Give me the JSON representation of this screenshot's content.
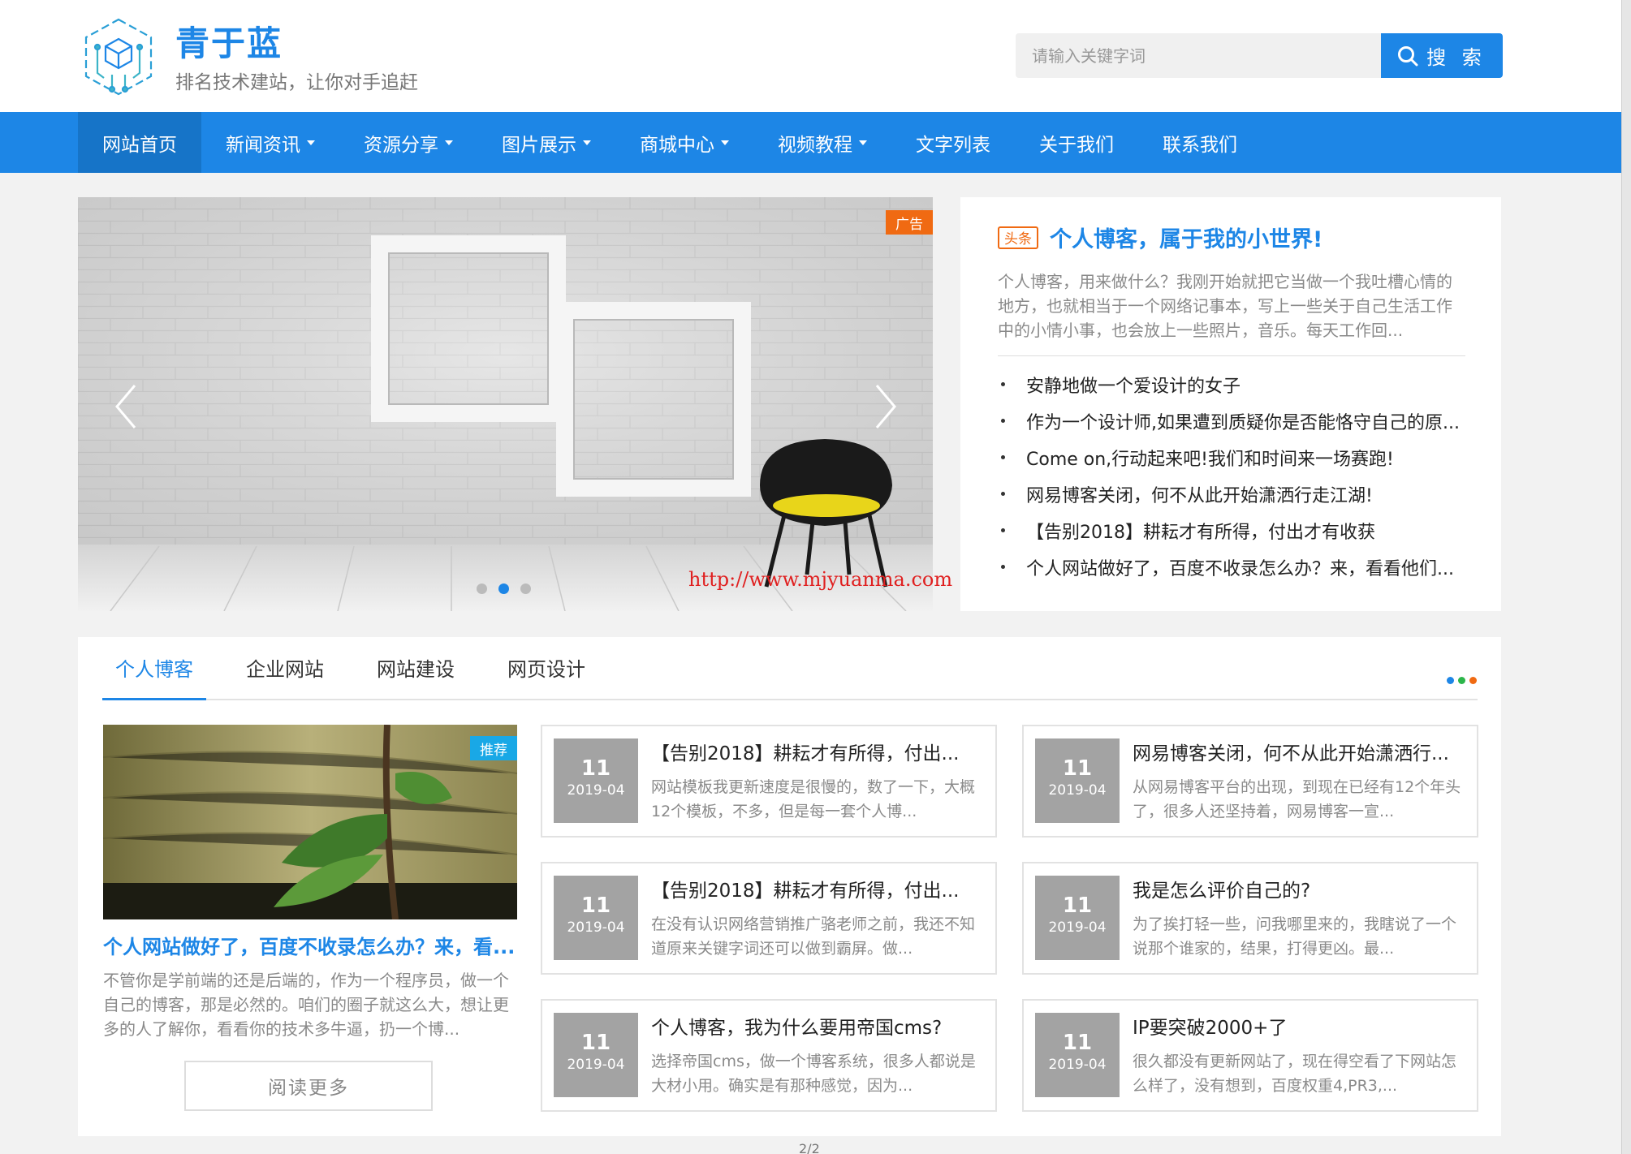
{
  "header": {
    "site_title": "青于蓝",
    "slogan": "排名技术建站，让你对手追赶",
    "search_placeholder": "请输入关键字词",
    "search_label": "搜 索"
  },
  "nav": {
    "items": [
      {
        "label": "网站首页",
        "dropdown": false
      },
      {
        "label": "新闻资讯",
        "dropdown": true
      },
      {
        "label": "资源分享",
        "dropdown": true
      },
      {
        "label": "图片展示",
        "dropdown": true
      },
      {
        "label": "商城中心",
        "dropdown": true
      },
      {
        "label": "视频教程",
        "dropdown": true
      },
      {
        "label": "文字列表",
        "dropdown": false
      },
      {
        "label": "关于我们",
        "dropdown": false
      },
      {
        "label": "联系我们",
        "dropdown": false
      }
    ]
  },
  "slider": {
    "ad_label": "广告",
    "watermark": "http://www.mjyuanma.com",
    "active_dot": 2,
    "dot_count": 3
  },
  "headline": {
    "tag": "头条",
    "title": "个人博客，属于我的小世界!",
    "summary": "个人博客，用来做什么？我刚开始就把它当做一个我吐槽心情的地方，也就相当于一个网络记事本，写上一些关于自己生活工作中的小情小事，也会放上一些照片，音乐。每天工作回...",
    "list": [
      "安静地做一个爱设计的女子",
      "作为一个设计师,如果遭到质疑你是否能恪守自己的原...",
      "Come on,行动起来吧!我们和时间来一场赛跑!",
      "网易博客关闭，何不从此开始潇洒行走江湖!",
      "【告别2018】耕耘才有所得，付出才有收获",
      "个人网站做好了，百度不收录怎么办？来，看看他们..."
    ]
  },
  "panel": {
    "tabs": [
      "个人博客",
      "企业网站",
      "网站建设",
      "网页设计"
    ],
    "dot_colors": [
      "#1d86e6",
      "#2cb54a",
      "#f06a12"
    ],
    "featured": {
      "badge": "推荐",
      "title": "个人网站做好了，百度不收录怎么办？来，看...",
      "summary": "不管你是学前端的还是后端的，作为一个程序员，做一个自己的博客，那是必然的。咱们的圈子就这么大，想让更多的人了解你，看看你的技术多牛逼，扔一个博...",
      "read_more": "阅读更多"
    },
    "cards": [
      {
        "day": "11",
        "ym": "2019-04",
        "title": "【告别2018】耕耘才有所得，付出...",
        "summary": "网站模板我更新速度是很慢的，数了一下，大概12个模板，不多，但是每一套个人博..."
      },
      {
        "day": "11",
        "ym": "2019-04",
        "title": "网易博客关闭，何不从此开始潇洒行...",
        "summary": "从网易博客平台的出现，到现在已经有12个年头了，很多人还坚持着，网易博客一宣..."
      },
      {
        "day": "11",
        "ym": "2019-04",
        "title": "【告别2018】耕耘才有所得，付出...",
        "summary": "在没有认识网络营销推广骆老师之前，我还不知道原来关键字词还可以做到霸屏。做..."
      },
      {
        "day": "11",
        "ym": "2019-04",
        "title": "我是怎么评价自己的?",
        "summary": "为了挨打轻一些，问我哪里来的，我瞎说了一个说那个谁家的，结果，打得更凶。最..."
      },
      {
        "day": "11",
        "ym": "2019-04",
        "title": "个人博客，我为什么要用帝国cms?",
        "summary": "选择帝国cms，做一个博客系统，很多人都说是大材小用。确实是有那种感觉，因为..."
      },
      {
        "day": "11",
        "ym": "2019-04",
        "title": "IP要突破2000+了",
        "summary": "很久都没有更新网站了，现在得空看了下网站怎么样了，没有想到，百度权重4,PR3,..."
      }
    ]
  },
  "pager": "2/2"
}
